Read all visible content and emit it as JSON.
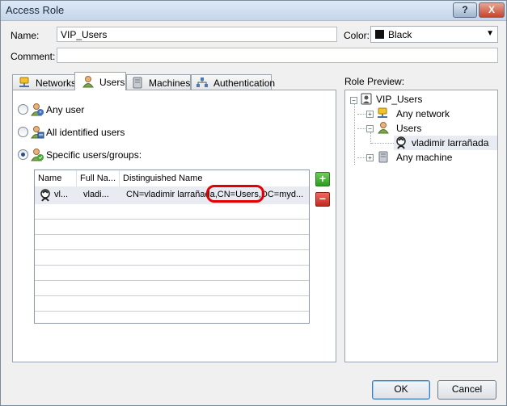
{
  "window": {
    "title": "Access Role",
    "help_label": "?",
    "close_label": "X"
  },
  "form": {
    "name_label": "Name:",
    "name_value": "VIP_Users",
    "color_label": "Color:",
    "color_value": "Black",
    "color_swatch": "#111111",
    "comment_label": "Comment:",
    "comment_value": ""
  },
  "tabs": [
    {
      "label": "Networks",
      "icon": "network-icon"
    },
    {
      "label": "Users",
      "icon": "users-icon",
      "active": true
    },
    {
      "label": "Machines",
      "icon": "machine-icon"
    },
    {
      "label": "Authentication",
      "icon": "authentication-icon"
    }
  ],
  "users_tab": {
    "options": [
      {
        "label": "Any user",
        "checked": false
      },
      {
        "label": "All identified users",
        "checked": false
      },
      {
        "label": "Specific users/groups:",
        "checked": true
      }
    ],
    "columns": [
      "Name",
      "Full Na...",
      "Distinguished Name"
    ],
    "rows": [
      {
        "name": "vl...",
        "full_name": "vladi...",
        "dn": "CN=vladimir larrañada,CN=Users,DC=myd..."
      }
    ],
    "add_label": "+",
    "remove_label": "−"
  },
  "preview": {
    "label": "Role Preview:",
    "root": "VIP_Users",
    "network": "Any network",
    "users": "Users",
    "user_item": "vladimir larrañada",
    "machine": "Any machine"
  },
  "buttons": {
    "ok": "OK",
    "cancel": "Cancel"
  },
  "colors": {
    "accent": "#3b7bbf",
    "highlight": "#e30000",
    "add": "#2f9a22",
    "remove": "#c22a1e"
  }
}
